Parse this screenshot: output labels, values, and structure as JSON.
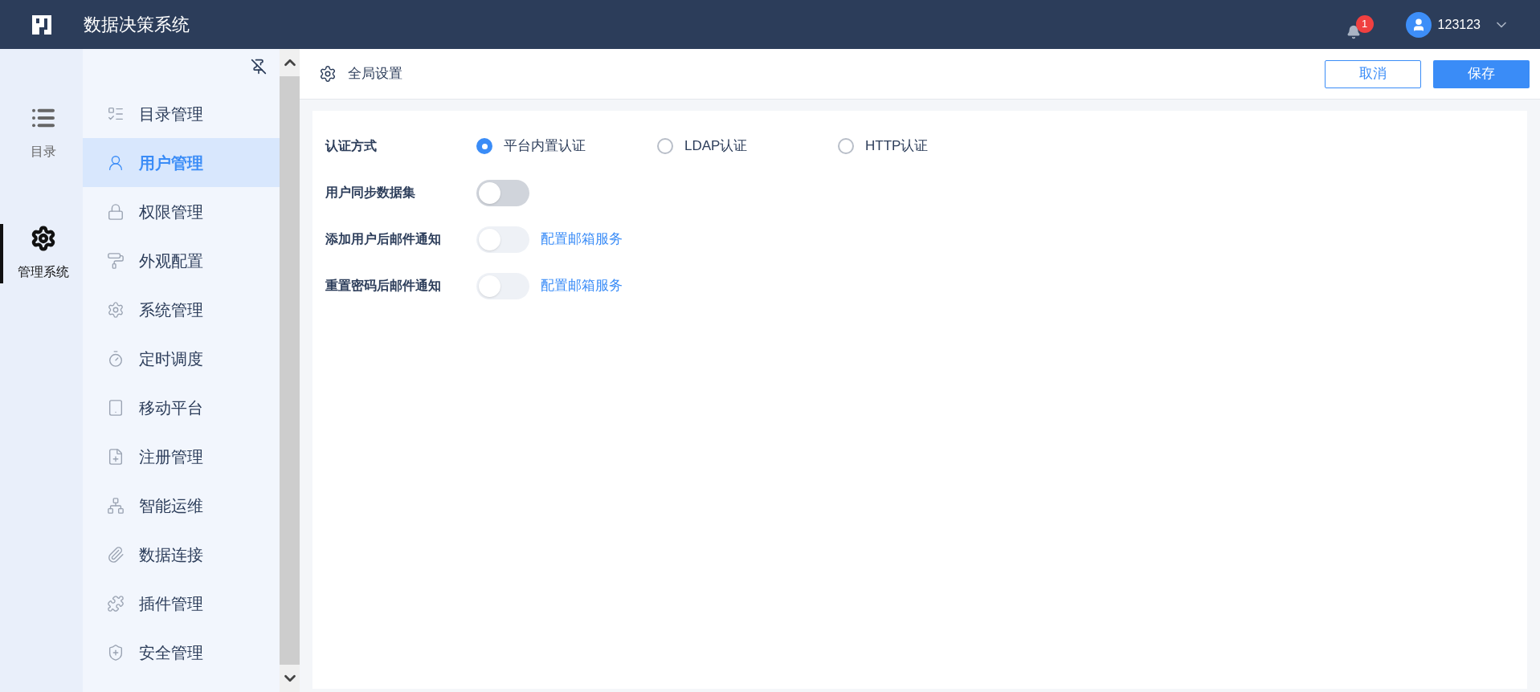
{
  "header": {
    "title": "数据决策系统",
    "notifications": "1",
    "user": "123123"
  },
  "rail": [
    {
      "label": "目录",
      "selected": false
    },
    {
      "label": "管理系统",
      "selected": true
    }
  ],
  "nav": [
    {
      "label": "目录管理",
      "selected": false
    },
    {
      "label": "用户管理",
      "selected": true
    },
    {
      "label": "权限管理",
      "selected": false
    },
    {
      "label": "外观配置",
      "selected": false
    },
    {
      "label": "系统管理",
      "selected": false
    },
    {
      "label": "定时调度",
      "selected": false
    },
    {
      "label": "移动平台",
      "selected": false
    },
    {
      "label": "注册管理",
      "selected": false
    },
    {
      "label": "智能运维",
      "selected": false
    },
    {
      "label": "数据连接",
      "selected": false
    },
    {
      "label": "插件管理",
      "selected": false
    },
    {
      "label": "安全管理",
      "selected": false
    }
  ],
  "page": {
    "title": "全局设置",
    "buttons": [
      {
        "label": "取消",
        "kind": "outline"
      },
      {
        "label": "保存",
        "kind": "primary"
      }
    ]
  },
  "settings": [
    {
      "kind": "radio",
      "label": "认证方式",
      "options": [
        {
          "label": "平台内置认证",
          "selected": true
        },
        {
          "label": "LDAP认证",
          "selected": false
        },
        {
          "label": "HTTP认证",
          "selected": false
        }
      ]
    },
    {
      "kind": "toggle",
      "label": "用户同步数据集",
      "on": false,
      "disabled": false
    },
    {
      "kind": "toggle",
      "label": "添加用户后邮件通知",
      "on": false,
      "disabled": true,
      "link": "配置邮箱服务"
    },
    {
      "kind": "toggle",
      "label": "重置密码后邮件通知",
      "on": false,
      "disabled": true,
      "link": "配置邮箱服务"
    }
  ]
}
